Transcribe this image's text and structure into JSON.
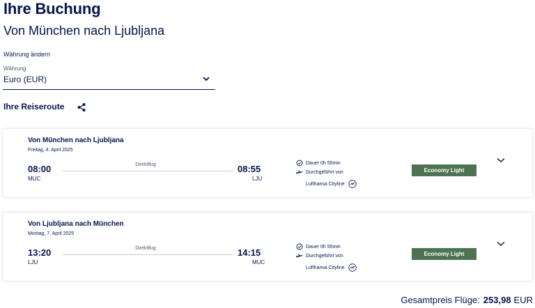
{
  "header": {
    "title": "Ihre Buchung",
    "subtitle": "Von München nach Ljubljana"
  },
  "currency": {
    "heading": "Währung ändern",
    "field_label": "Währung",
    "selected": "Euro (EUR)"
  },
  "itinerary": {
    "heading": "Ihre Reiseroute",
    "share_icon": "share-icon",
    "flights": [
      {
        "title": "Von München nach Ljubljana",
        "date": "Freitag, 4. April 2025",
        "dep_time": "08:00",
        "dep_code": "MUC",
        "arr_time": "08:55",
        "arr_code": "LJU",
        "stops": "Direktflug",
        "duration": "Dauer 0h 55min",
        "operated_by": "Durchgeführt von",
        "carrier": "Lufthansa Cityline",
        "fare": "Economy Light"
      },
      {
        "title": "Von Ljubljana nach München",
        "date": "Montag, 7. April 2025",
        "dep_time": "13:20",
        "dep_code": "LJU",
        "arr_time": "14:15",
        "arr_code": "MUC",
        "stops": "Direktflug",
        "duration": "Dauer 0h 55min",
        "operated_by": "Durchgeführt von",
        "carrier": "Lufthansa Cityline",
        "fare": "Economy Light"
      }
    ]
  },
  "total": {
    "label": "Gesamtpreis Flüge:",
    "amount": "253,98",
    "currency": "EUR"
  },
  "colors": {
    "brand_navy": "#05164d",
    "fare_green": "#4e7352"
  }
}
